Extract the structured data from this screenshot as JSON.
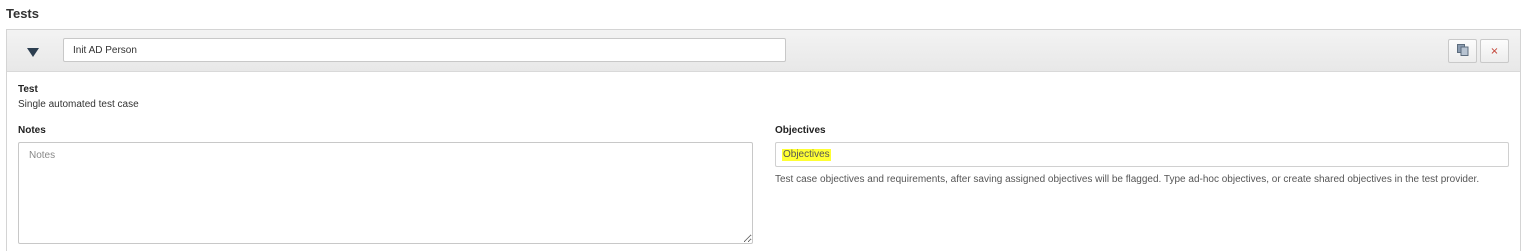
{
  "section": {
    "title": "Tests"
  },
  "test_item": {
    "name_value": "Init AD Person",
    "type_label": "Test",
    "type_description": "Single automated test case"
  },
  "icons": {
    "toggle": "collapse-triangle-down-icon",
    "copy": "copy-icon",
    "remove": "close-icon",
    "resize": "resize-grip-icon"
  },
  "buttons": {
    "remove_glyph": "×"
  },
  "notes": {
    "label": "Notes",
    "placeholder": "Notes"
  },
  "objectives": {
    "label": "Objectives",
    "placeholder": "Objectives",
    "help": "Test case objectives and requirements, after saving assigned objectives will be flagged. Type ad-hoc objectives, or create shared objectives in the test provider."
  },
  "colors": {
    "highlight": "#ffff33",
    "remove_icon": "#c0392b",
    "toggle_icon": "#2c3e50",
    "header_bg": "#ececec"
  }
}
